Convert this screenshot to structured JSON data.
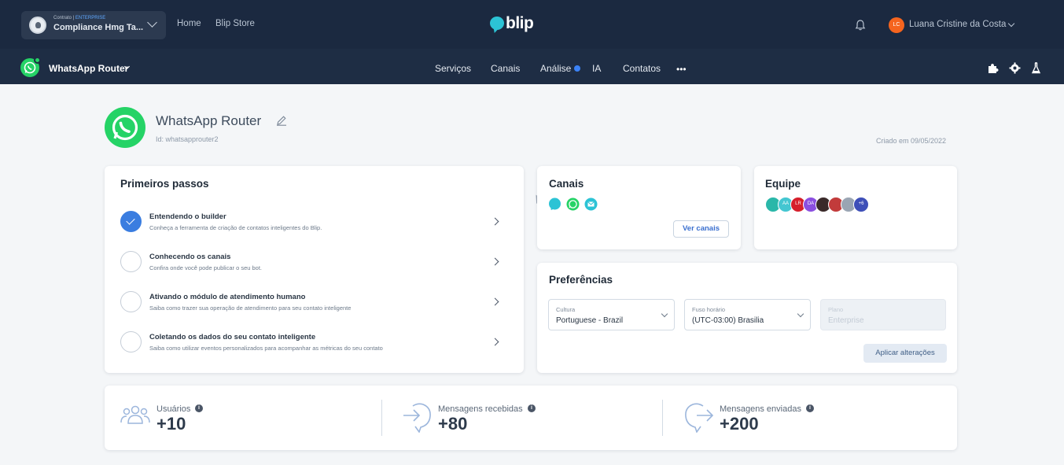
{
  "topbar": {
    "contract_label": "Contrato | ",
    "contract_plan": "ENTERPRISE",
    "contract_name": "Compliance Hmg Ta...",
    "nav": [
      "Home",
      "Blip Store"
    ],
    "logo_text": "blip",
    "user_initials": "LC",
    "user_name": "Luana Cristine da Costa"
  },
  "subbar": {
    "bot_name": "WhatsApp Router",
    "nav": [
      "Serviços",
      "Canais",
      "Análise",
      "IA",
      "Contatos"
    ],
    "more": "•••"
  },
  "bot": {
    "title": "WhatsApp Router",
    "id": "Id: whatsapprouter2",
    "created": "Criado em 09/05/2022"
  },
  "first_steps": {
    "title": "Primeiros passos",
    "steps": [
      {
        "title": "Entendendo o builder",
        "desc": "Conheça a ferramenta de criação de contatos inteligentes do Blip.",
        "done": true
      },
      {
        "title": "Conhecendo os canais",
        "desc": "Confira onde você pode publicar o seu bot.",
        "done": false
      },
      {
        "title": "Ativando o módulo de atendimento humano",
        "desc": "Saiba como trazer sua operação de atendimento para seu contato inteligente",
        "done": false
      },
      {
        "title": "Coletando os dados do seu contato inteligente",
        "desc": "Saiba como utilizar eventos personalizados para acompanhar as métricas do seu contato",
        "done": false
      }
    ]
  },
  "channels": {
    "title": "Canais",
    "button": "Ver canais",
    "icons": [
      "blip-chat-icon",
      "whatsapp-icon",
      "email-icon"
    ]
  },
  "team": {
    "title": "Equipe",
    "members": [
      {
        "initials": "",
        "color": "#2ab7a9"
      },
      {
        "initials": "AA",
        "color": "#44c6d1"
      },
      {
        "initials": "LR",
        "color": "#d61f2b"
      },
      {
        "initials": "DA",
        "color": "#8b4fe0"
      },
      {
        "initials": "",
        "color": "#3a2a2a"
      },
      {
        "initials": "",
        "color": "#c23b3b"
      },
      {
        "initials": "",
        "color": "#9aa5b3"
      },
      {
        "initials": "+6",
        "color": "#3e4fb8"
      }
    ]
  },
  "preferences": {
    "title": "Preferências",
    "culture": {
      "label": "Cultura",
      "value": "Portuguese - Brazil"
    },
    "timezone": {
      "label": "Fuso horário",
      "value": "(UTC-03:00) Brasilia"
    },
    "plan": {
      "label": "Plano",
      "value": "Enterprise"
    },
    "apply": "Aplicar alterações"
  },
  "stats": [
    {
      "label": "Usuários",
      "value": "+10"
    },
    {
      "label": "Mensagens recebidas",
      "value": "+80"
    },
    {
      "label": "Mensagens enviadas",
      "value": "+200"
    }
  ],
  "colors": {
    "topbar": "#1b2940",
    "accent": "#3a7de0",
    "whatsapp": "#25d366",
    "background": "#f4f6f8"
  }
}
